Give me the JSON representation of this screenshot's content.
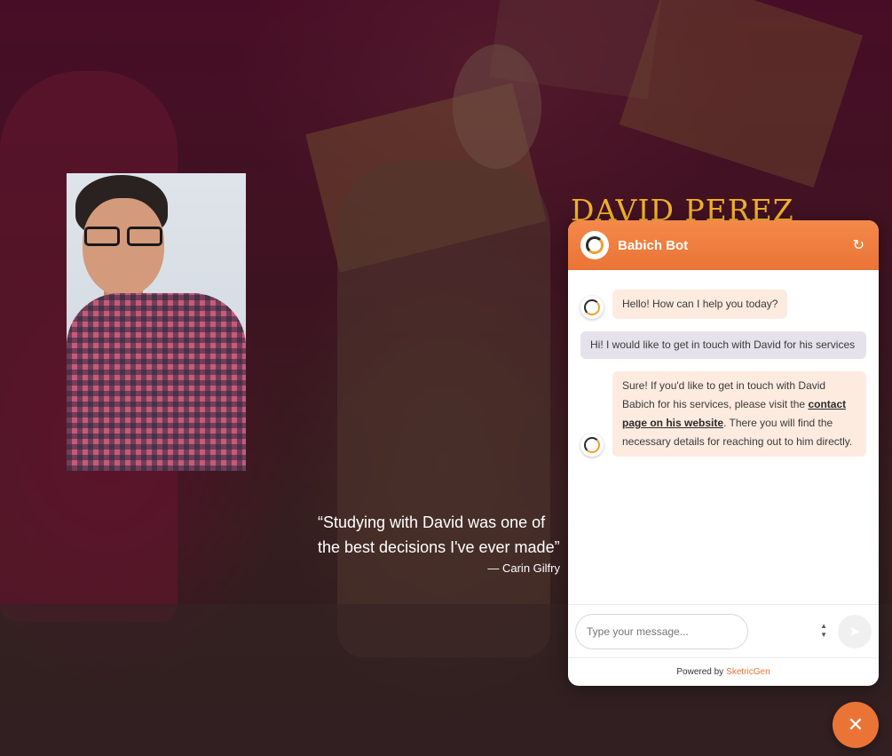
{
  "hero": {
    "name": "DAVID PEREZ"
  },
  "testimonial": {
    "quote": "“Studying with David was one of the best decisions I've ever made”",
    "author": "— Carin Gilfry"
  },
  "chat": {
    "title": "Babich Bot",
    "messages": [
      {
        "from": "bot",
        "text": "Hello! How can I help you today?"
      },
      {
        "from": "user",
        "text": "Hi! I would like to get in touch with David for his services"
      },
      {
        "from": "bot",
        "pre": "Sure! If you'd like to get in touch with David Babich for his services, please visit the ",
        "link": "contact page on his website",
        "post": ". There you will find the necessary details for reaching out to him directly."
      }
    ],
    "input_placeholder": "Type your message...",
    "powered_by": "Powered by",
    "brand": "SketricGen"
  },
  "colors": {
    "accent": "#ea7436",
    "gold": "#f0b028"
  },
  "icons": {
    "refresh": "refresh-icon",
    "send": "send-icon",
    "close": "close-icon"
  }
}
